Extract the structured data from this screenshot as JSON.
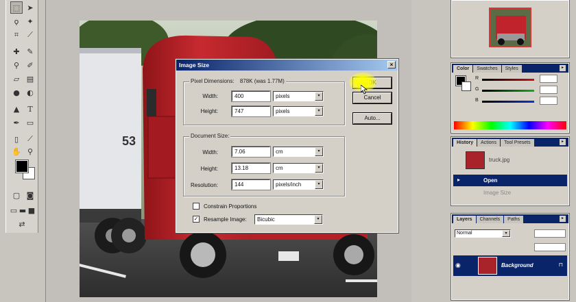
{
  "toolbox": {
    "tools": [
      "marquee-tool",
      "move-tool",
      "lasso-tool",
      "magic-wand-tool",
      "crop-tool",
      "slice-tool",
      "healing-brush-tool",
      "brush-tool",
      "clone-stamp-tool",
      "history-brush-tool",
      "eraser-tool",
      "gradient-tool",
      "blur-tool",
      "dodge-tool",
      "path-selection-tool",
      "type-tool",
      "pen-tool",
      "shape-tool",
      "notes-tool",
      "eyedropper-tool",
      "hand-tool",
      "zoom-tool"
    ]
  },
  "dialog": {
    "title": "Image Size",
    "close_glyph": "×",
    "pixel_dimensions": {
      "label": "Pixel Dimensions:",
      "size": "878K (was 1.77M)",
      "width_label": "Width:",
      "width_value": "400",
      "width_unit": "pixels",
      "height_label": "Height:",
      "height_value": "747",
      "height_unit": "pixels"
    },
    "document_size": {
      "label": "Document Size:",
      "width_label": "Width:",
      "width_value": "7.06",
      "width_unit": "cm",
      "height_label": "Height:",
      "height_value": "13.18",
      "height_unit": "cm",
      "resolution_label": "Resolution:",
      "resolution_value": "144",
      "resolution_unit": "pixels/inch"
    },
    "constrain_label": "Constrain Proportions",
    "constrain_checked": false,
    "resample_label": "Resample Image:",
    "resample_checked": true,
    "resample_method": "Bicubic",
    "ok_label": "OK",
    "cancel_label": "Cancel",
    "auto_label": "Auto..."
  },
  "palettes": {
    "color": {
      "tabs": [
        "Color",
        "Swatches",
        "Styles"
      ],
      "channels": [
        "R",
        "G",
        "B"
      ],
      "slider_colors": [
        "#cc1111",
        "#11aa22",
        "#1133cc"
      ]
    },
    "history": {
      "tabs": [
        "History",
        "Actions",
        "Tool Presets"
      ],
      "snapshot": "truck.jpg",
      "steps": [
        "Open",
        "Image Size"
      ],
      "selected_step": "Open"
    },
    "layers": {
      "tabs": [
        "Layers",
        "Channels",
        "Paths"
      ],
      "blend_mode": "Normal",
      "layer_name": "Background"
    }
  },
  "colors": {
    "titlebar": "#0a246a",
    "dialog_bg": "#d4d0c8",
    "ok_highlight": "#ffff00",
    "truck_red": "#c0232b"
  },
  "icons": {
    "checkbox_mark": "✓",
    "dropdown_arrow": "▾",
    "eye_icon": "👁",
    "cursor": "arrow-cursor"
  }
}
